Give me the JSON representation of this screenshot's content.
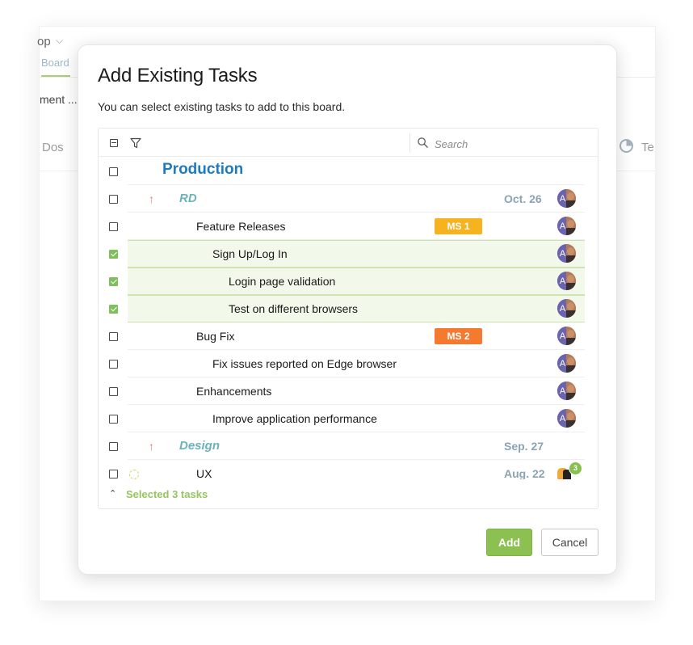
{
  "background": {
    "app_label": "op",
    "tab_board": "Board",
    "truncated_text": "ment ...",
    "column_left": "Dos",
    "column_right": "Te"
  },
  "dialog": {
    "title": "Add Existing Tasks",
    "subtitle": "You can select existing tasks to add to this board.",
    "search_placeholder": "Search",
    "rows": [
      {
        "label": "Production",
        "kind": "project",
        "checked": false
      },
      {
        "label": "RD",
        "kind": "group",
        "checked": false,
        "date": "Oct. 26",
        "avatar": "A"
      },
      {
        "label": "Feature Releases",
        "kind": "task",
        "checked": false,
        "badge": "MS 1",
        "avatar": "A"
      },
      {
        "label": "Sign Up/Log In",
        "kind": "task",
        "checked": true,
        "avatar": "A"
      },
      {
        "label": "Login page validation",
        "kind": "task",
        "checked": true,
        "avatar": "A"
      },
      {
        "label": "Test on different browsers",
        "kind": "task",
        "checked": true,
        "avatar": "A"
      },
      {
        "label": "Bug Fix",
        "kind": "task",
        "checked": false,
        "badge": "MS 2",
        "avatar": "A"
      },
      {
        "label": "Fix issues reported on Edge browser",
        "kind": "task",
        "checked": false,
        "avatar": "A"
      },
      {
        "label": "Enhancements",
        "kind": "task",
        "checked": false,
        "avatar": "A"
      },
      {
        "label": "Improve application performance",
        "kind": "task",
        "checked": false,
        "avatar": "A"
      },
      {
        "label": "Design",
        "kind": "group",
        "checked": false,
        "date": "Sep. 27"
      },
      {
        "label": "UX",
        "kind": "task",
        "checked": false,
        "date": "Aug. 22",
        "assignee_count": "3"
      }
    ],
    "selected_summary": "Selected 3 tasks",
    "add_label": "Add",
    "cancel_label": "Cancel"
  },
  "colors": {
    "project_blue": "#1f7bbf",
    "group_teal": "#6bb3b8",
    "ms1_badge": "#f7b21f",
    "ms2_badge": "#f47a30",
    "selected_row": "#f2f8ea",
    "add_button": "#8cc152",
    "summary_green": "#95c55e"
  }
}
